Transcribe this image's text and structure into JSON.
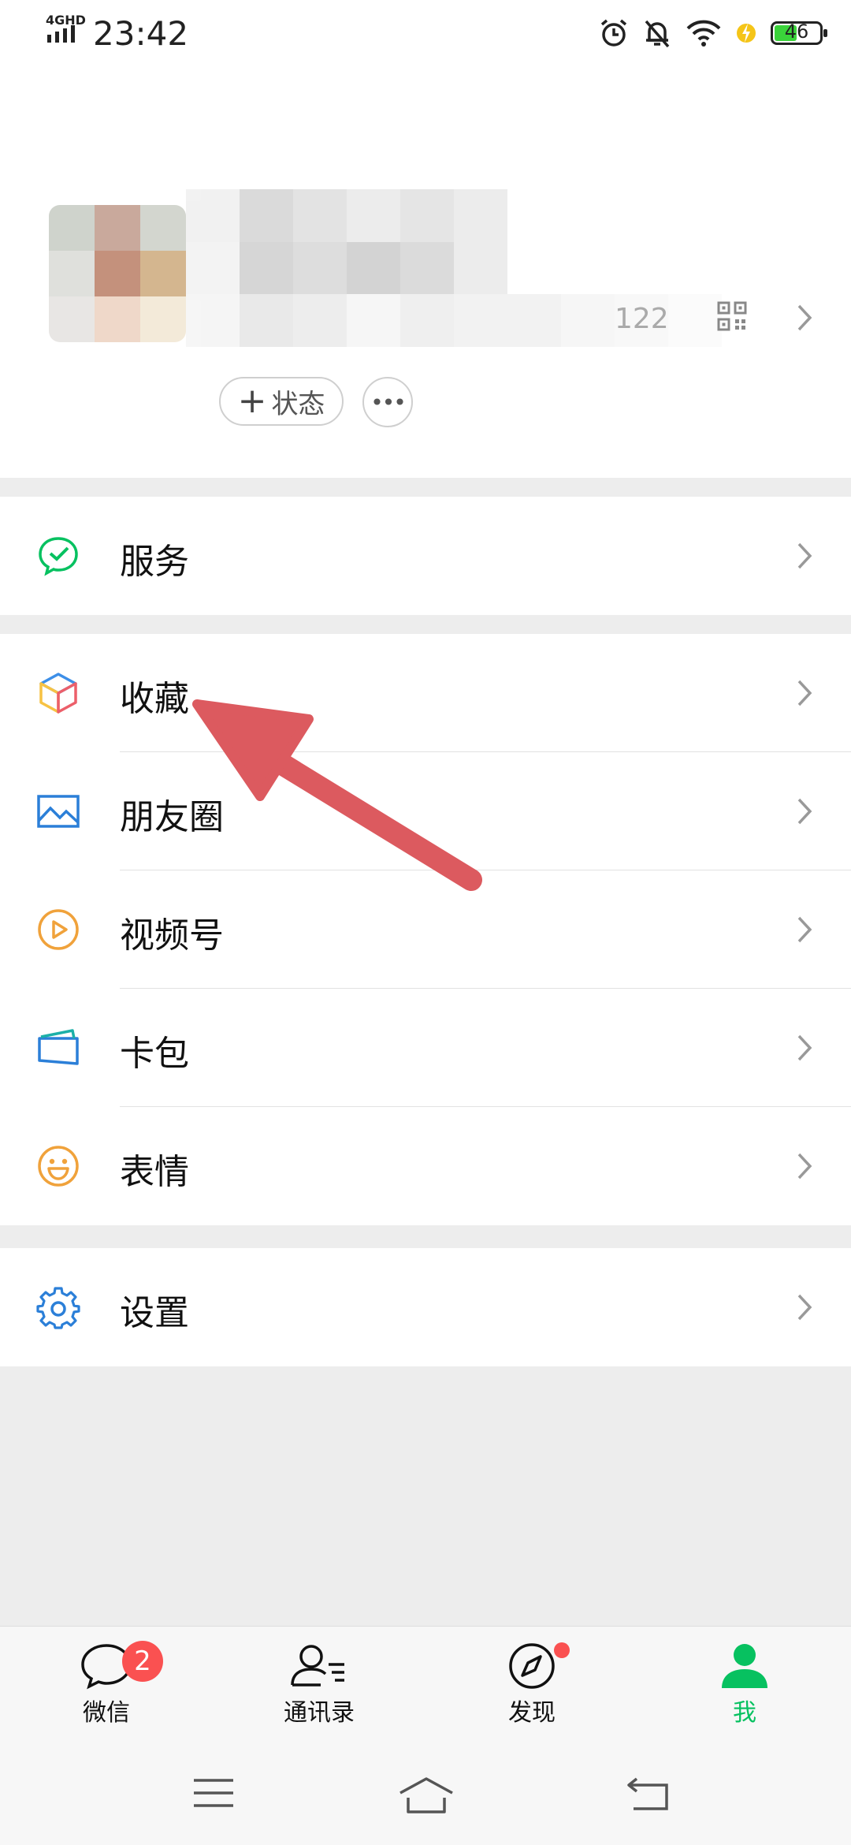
{
  "status_bar": {
    "network": "4GHD",
    "time": "23:42",
    "battery": "46",
    "icons": [
      "signal-icon",
      "alarm-icon",
      "mute-icon",
      "wifi-icon",
      "charging-icon",
      "battery-icon"
    ]
  },
  "profile": {
    "id_tail": "122",
    "status_button": "状态",
    "status_plus": "+",
    "more": "•••"
  },
  "menu": {
    "service": "服务",
    "favorites": "收藏",
    "moments": "朋友圈",
    "channels": "视频号",
    "cards": "卡包",
    "stickers": "表情",
    "settings": "设置"
  },
  "tabs": {
    "chats": "微信",
    "chats_badge": "2",
    "contacts": "通讯录",
    "discover": "发现",
    "me": "我"
  },
  "colors": {
    "accent": "#07c160",
    "badge": "#fa5151",
    "arrow": "#dc5a5f",
    "background": "#ededed"
  }
}
